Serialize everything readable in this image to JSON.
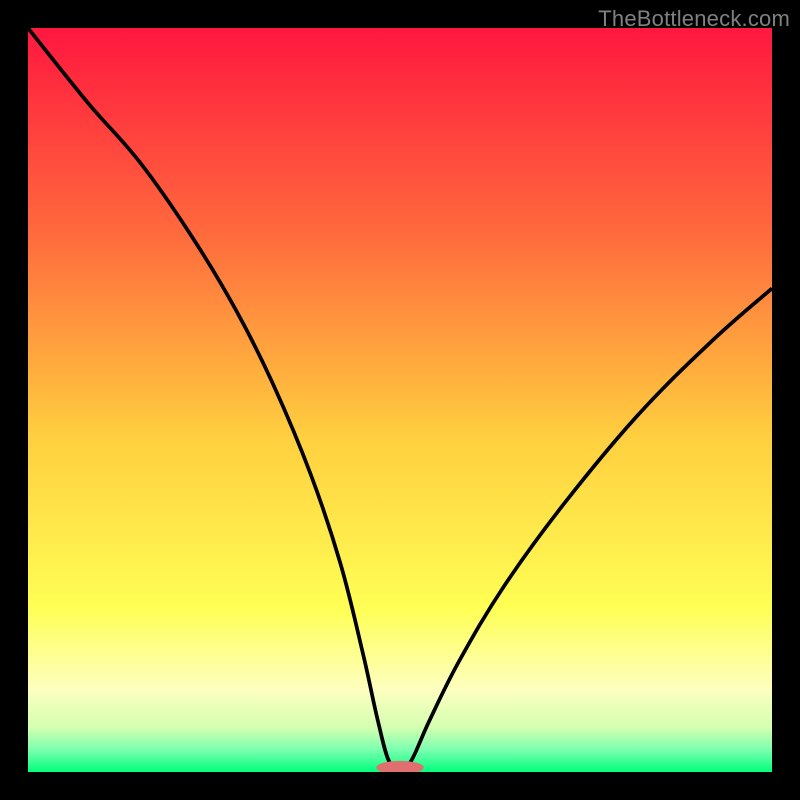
{
  "watermark": "TheBottleneck.com",
  "colors": {
    "background": "#000000",
    "gradient_top": "#ff173f",
    "gradient_orange": "#ff9740",
    "gradient_yellow": "#ffe73f",
    "gradient_pale": "#fbffa2",
    "gradient_bottom": "#00ff7c",
    "curve": "#000000",
    "marker": "#e07070"
  },
  "chart_data": {
    "type": "line",
    "title": "",
    "xlabel": "",
    "ylabel": "",
    "xlim": [
      0,
      100
    ],
    "ylim": [
      0,
      100
    ],
    "annotations": [
      "TheBottleneck.com"
    ],
    "series": [
      {
        "name": "bottleneck-curve",
        "x_start_at_top_left": true,
        "points_xy_percent": [
          [
            0,
            100
          ],
          [
            8,
            90
          ],
          [
            15,
            82
          ],
          [
            22,
            72
          ],
          [
            28,
            62
          ],
          [
            33,
            52
          ],
          [
            38,
            40
          ],
          [
            42,
            28
          ],
          [
            45,
            16
          ],
          [
            47,
            7
          ],
          [
            48.5,
            1.5
          ],
          [
            50,
            0.5
          ],
          [
            51.5,
            1.5
          ],
          [
            54,
            7
          ],
          [
            58,
            15
          ],
          [
            64,
            25
          ],
          [
            72,
            36
          ],
          [
            82,
            48
          ],
          [
            92,
            58
          ],
          [
            100,
            65
          ]
        ]
      }
    ],
    "marker": {
      "name": "optimal-band",
      "cx_percent": 50,
      "cy_percent": 0.6,
      "rx_percent": 3.2,
      "ry_percent": 0.9
    },
    "gradient_stops_percent_from_top": [
      {
        "offset": 0,
        "color": "#ff173f"
      },
      {
        "offset": 28,
        "color": "#ff6b3d"
      },
      {
        "offset": 55,
        "color": "#ffcf3f"
      },
      {
        "offset": 78,
        "color": "#ffff55"
      },
      {
        "offset": 89,
        "color": "#fdffc0"
      },
      {
        "offset": 94,
        "color": "#d4ffb0"
      },
      {
        "offset": 97,
        "color": "#7cffb0"
      },
      {
        "offset": 100,
        "color": "#00ff7c"
      }
    ]
  }
}
